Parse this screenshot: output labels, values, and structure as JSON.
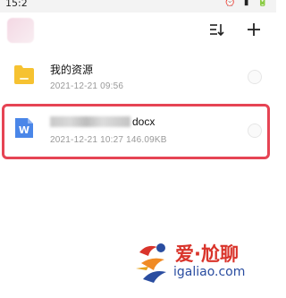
{
  "status_bar": {
    "time": "15:2",
    "icons": "⏰ ▮ 🔋"
  },
  "toolbar": {
    "sort_icon": "sort-icon",
    "add_icon": "plus-icon"
  },
  "files": [
    {
      "name": "我的资源",
      "meta": "2021-12-21  09:56",
      "type": "folder",
      "icon_color": "#f6c231"
    },
    {
      "name_suffix": "docx",
      "meta": "2021-12-21  10:27  146.09KB",
      "type": "word-doc",
      "icon_color": "#4a86e8",
      "highlighted": true
    }
  ],
  "highlight_color": "#e64454",
  "watermark": {
    "cn": "爱·尬聊",
    "en": "igaliao.com"
  }
}
